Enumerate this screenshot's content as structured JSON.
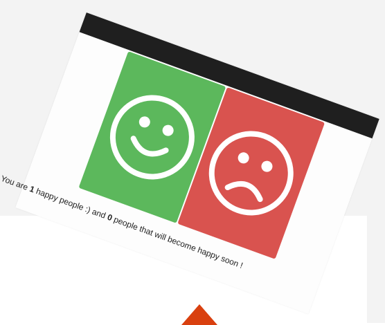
{
  "message": {
    "part1": "You are ",
    "happy_count": "1",
    "part2": " happy people :) and ",
    "sad_count": "0",
    "part3": " people that will become happy soon !"
  },
  "buttons": {
    "happy": {
      "icon": "smiley-face-icon",
      "color": "#5cb85c"
    },
    "sad": {
      "icon": "sad-face-icon",
      "color": "#d9534f"
    }
  },
  "colors": {
    "header": "#1f1f1f",
    "accent_shape": "#d9400f"
  }
}
